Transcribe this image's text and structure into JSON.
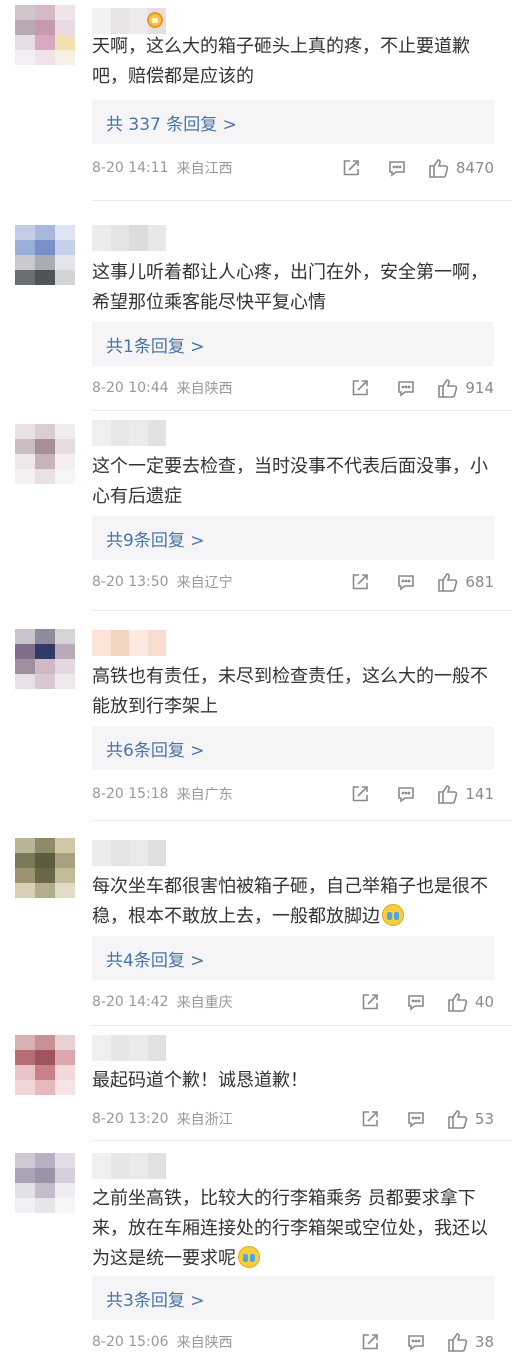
{
  "comments": [
    {
      "text": "天啊，这么大的箱子砸头上真的疼，不止要道歉吧，赔偿都是应该的",
      "replies": "共 337 条回复 >",
      "date": "8-20 14:11",
      "location": "来自江西",
      "likes": "8470",
      "avatar_colors": [
        "#cfc6cc",
        "#d4b9c7",
        "#eee4ea",
        "#b8a9b6",
        "#c79ab1",
        "#e9d9e3",
        "#e6dde5",
        "#d8a8c0",
        "#f2e0b0",
        "#f5eef2",
        "#efe3ea",
        "#f6f1e6"
      ],
      "nick_colors": [
        "#f3f1f2",
        "#e8e3e6",
        "#eeeaec",
        "#e5dfe3"
      ]
    },
    {
      "text": "这事儿听着都让人心疼，出门在外，安全第一啊，希望那位乘客能尽快平复心情",
      "replies": "共1条回复 >",
      "date": "8-20 10:44",
      "location": "来自陕西",
      "likes": "914",
      "avatar_colors": [
        "#c3cde8",
        "#a9b6de",
        "#dfe4f2",
        "#9aaed9",
        "#7a8fc8",
        "#c6d0ea",
        "#c9c9cf",
        "#a7acb5",
        "#e4e5ea",
        "#6b6f73",
        "#4f5458",
        "#d2d4d8"
      ],
      "nick_colors": [
        "#ececee",
        "#e4e4e7",
        "#dcdcdf",
        "#e8e8ea"
      ]
    },
    {
      "text": "这个一定要去检查，当时没事不代表后面没事，小心有后遗症",
      "replies": "共9条回复 >",
      "date": "8-20 13:50",
      "location": "来自辽宁",
      "likes": "681",
      "avatar_colors": [
        "#e8e1e3",
        "#d9cdd1",
        "#f1eced",
        "#cbbcc0",
        "#a88f97",
        "#e6dbde",
        "#efe7e9",
        "#c7b3b9",
        "#f3eeef",
        "#f5f1f2",
        "#e9e0e3",
        "#f7f4f5"
      ],
      "nick_colors": [
        "#efefef",
        "#e7e7e7",
        "#ebebeb",
        "#e2e2e2"
      ]
    },
    {
      "text": "高铁也有责任，未尽到检查责任，这么大的一般不能放到行李架上",
      "replies": "共6条回复 >",
      "date": "8-20 15:18",
      "location": "来自广东",
      "likes": "141",
      "avatar_colors": [
        "#c9c4cc",
        "#8f8a9c",
        "#d8d2d9",
        "#7f6f8a",
        "#2f3b66",
        "#b9a9b9",
        "#a08da0",
        "#cfb9c6",
        "#e3d6de",
        "#e8e0e6",
        "#d8c8d2",
        "#efe8ed"
      ],
      "nick_colors": [
        "#fbe3d6",
        "#f5d3c1",
        "#fde9dd",
        "#f8dccd"
      ]
    },
    {
      "text": "每次坐车都很害怕被箱子砸，自己举箱子也是很不稳，根本不敢放上去，一般都放脚边",
      "replies": "共4条回复 >",
      "date": "8-20 14:42",
      "location": "来自重庆",
      "likes": "40",
      "avatar_colors": [
        "#b9b39a",
        "#8e8a66",
        "#cfc7a8",
        "#7b7a58",
        "#5d5c40",
        "#a7a180",
        "#9b946f",
        "#6a6848",
        "#c2bb98",
        "#d6d0b6",
        "#b4ad8c",
        "#e1dcc6"
      ],
      "nick_colors": [
        "#ececec",
        "#e3e3e3",
        "#e9e9e9",
        "#dfdfdf"
      ]
    },
    {
      "text": "最起码道个歉！诚恳道歉！",
      "replies": "",
      "date": "8-20 13:20",
      "location": "来自浙江",
      "likes": "53",
      "avatar_colors": [
        "#d7b1b3",
        "#c88f94",
        "#e8cfd1",
        "#b86d74",
        "#a2545d",
        "#dca8ad",
        "#e9c3c6",
        "#c98088",
        "#f2d8da",
        "#f1d5d7",
        "#e6b9bd",
        "#f6e4e5"
      ],
      "nick_colors": [
        "#efefef",
        "#e6e6e6",
        "#eaeaea",
        "#e1e1e1"
      ]
    },
    {
      "text": "之前坐高铁，比较大的行李箱乘务 员都要求拿下来，放在车厢连接处的行李箱架或空位处，我还以为这是统一要求呢",
      "replies": "共3条回复 >",
      "date": "8-20 15:06",
      "location": "来自陕西",
      "likes": "38",
      "avatar_colors": [
        "#cfc9d6",
        "#b7b0c3",
        "#e2dde7",
        "#aaa2b8",
        "#9a94a8",
        "#d4cfdb",
        "#e4e0e8",
        "#c3bdcb",
        "#efedf2",
        "#f2f0f4",
        "#e7e4ea",
        "#f6f5f7"
      ],
      "nick_colors": [
        "#efefef",
        "#e6e6e6",
        "#eaeaea",
        "#e1e1e1"
      ]
    }
  ],
  "icons": {
    "share": "share-icon",
    "comment": "comment-icon",
    "like": "like-icon",
    "emoji": "crying-emoji-icon",
    "badge": "member-badge-icon"
  },
  "colors": {
    "link": "#4a73a8",
    "meta": "#999999",
    "reply_bg": "#f5f5f7",
    "text": "#333333"
  }
}
